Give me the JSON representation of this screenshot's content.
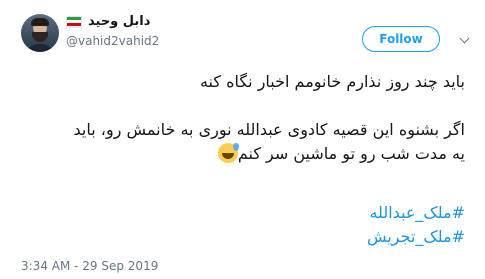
{
  "user": {
    "display_name": "دابل وحید",
    "handle": "@vahid2vahid2",
    "flag_colors": [
      "#239f40",
      "#ffffff",
      "#da0000"
    ]
  },
  "actions": {
    "follow_label": "Follow"
  },
  "tweet": {
    "line1": "باید چند روز نذارم خانومم اخبار نگاه کنه",
    "line2": "اگر بشنوه این قصیه کادوی عبدالله نوری به خانمش رو، باید",
    "line3": "یه مدت شب رو تو ماشین سر کنم",
    "hashtags": [
      "#ملک_عبدالله",
      "#ملک_تجریش"
    ],
    "timestamp": "3:34 AM - 29 Sep 2019"
  },
  "colors": {
    "accent": "#1da1f2",
    "hashtag": "#1b95e0",
    "muted": "#657786"
  }
}
